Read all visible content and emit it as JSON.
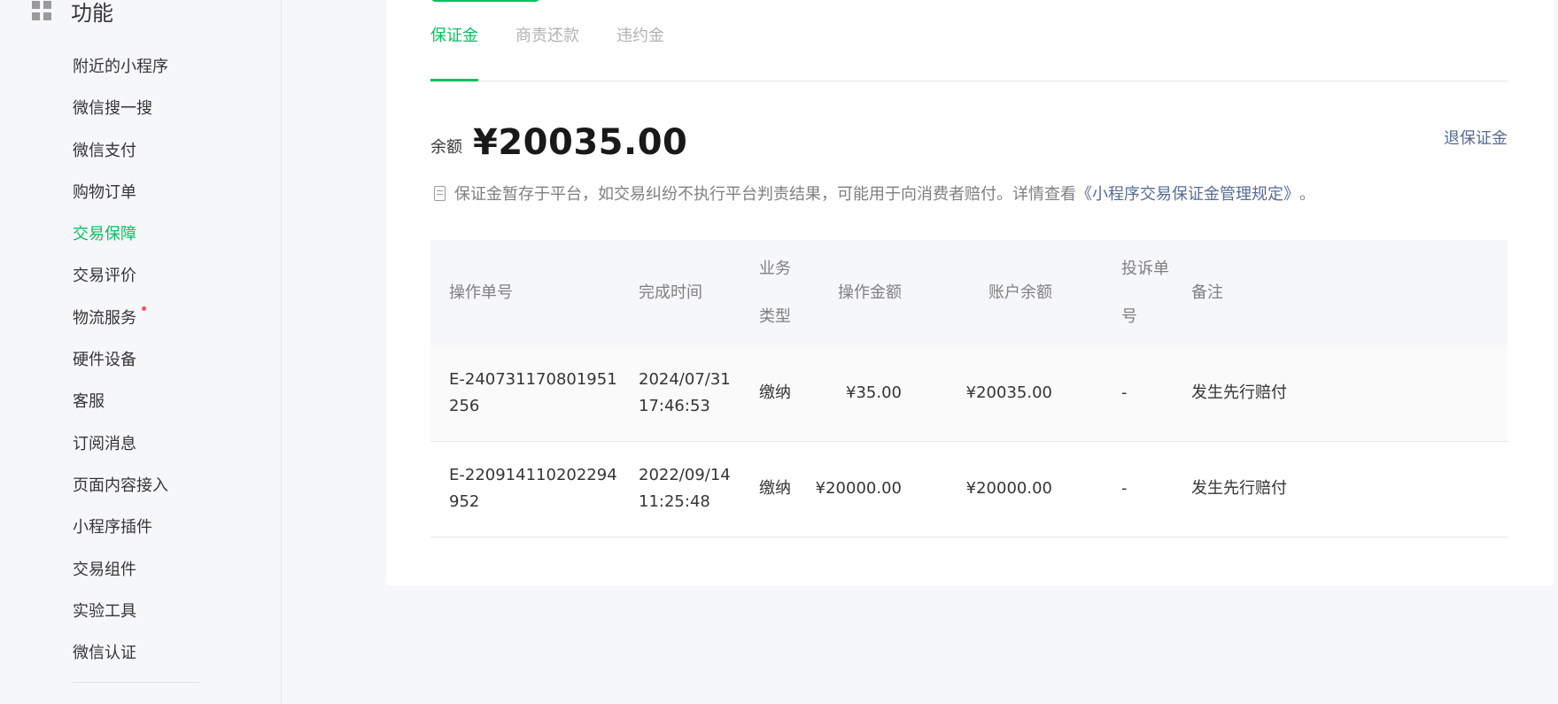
{
  "sidebar": {
    "section_title": "功能",
    "items": [
      {
        "label": "附近的小程序",
        "active": false,
        "dot": false
      },
      {
        "label": "微信搜一搜",
        "active": false,
        "dot": false
      },
      {
        "label": "微信支付",
        "active": false,
        "dot": false
      },
      {
        "label": "购物订单",
        "active": false,
        "dot": false
      },
      {
        "label": "交易保障",
        "active": true,
        "dot": false
      },
      {
        "label": "交易评价",
        "active": false,
        "dot": false
      },
      {
        "label": "物流服务",
        "active": false,
        "dot": true
      },
      {
        "label": "硬件设备",
        "active": false,
        "dot": false
      },
      {
        "label": "客服",
        "active": false,
        "dot": false
      },
      {
        "label": "订阅消息",
        "active": false,
        "dot": false
      },
      {
        "label": "页面内容接入",
        "active": false,
        "dot": false
      },
      {
        "label": "小程序插件",
        "active": false,
        "dot": false
      },
      {
        "label": "交易组件",
        "active": false,
        "dot": false
      },
      {
        "label": "实验工具",
        "active": false,
        "dot": false
      },
      {
        "label": "微信认证",
        "active": false,
        "dot": false
      }
    ]
  },
  "tabs": [
    {
      "label": "保证金",
      "active": true
    },
    {
      "label": "商责还款",
      "active": false
    },
    {
      "label": "违约金",
      "active": false
    }
  ],
  "balance": {
    "label": "余额",
    "value": "¥20035.00",
    "refund_link": "退保证金"
  },
  "notice": {
    "text": "保证金暂存于平台，如交易纠纷不执行平台判责结果，可能用于向消费者赔付。详情查看",
    "link": "《小程序交易保证金管理规定》",
    "suffix": "。"
  },
  "table": {
    "headers": {
      "id": "操作单号",
      "time": "完成时间",
      "type": "业务类型",
      "amount": "操作金额",
      "balance": "账户余额",
      "complaint": "投诉单号",
      "note": "备注"
    },
    "rows": [
      {
        "id": "E-240731170801951256",
        "time": "2024/07/31 17:46:53",
        "type": "缴纳",
        "amount": "¥35.00",
        "balance": "¥20035.00",
        "complaint": "-",
        "note": "发生先行赔付"
      },
      {
        "id": "E-220914110202294952",
        "time": "2022/09/14 11:25:48",
        "type": "缴纳",
        "amount": "¥20000.00",
        "balance": "¥20000.00",
        "complaint": "-",
        "note": "发生先行赔付"
      }
    ]
  },
  "colors": {
    "accent": "#07c160",
    "link": "#576b95",
    "dot": "#fa5151"
  }
}
